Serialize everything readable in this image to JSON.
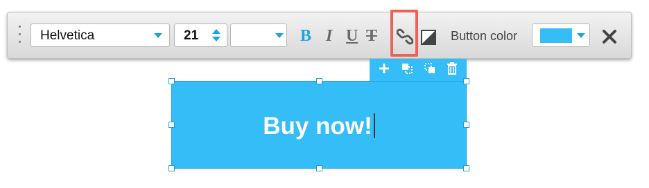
{
  "toolbar": {
    "font_family": "Helvetica",
    "font_size": "21",
    "style_value": "",
    "bold_label": "B",
    "italic_label": "I",
    "underline_label": "U",
    "strike_label": "T",
    "color_label": "Button color",
    "color_value": "#35bdf7"
  },
  "button_element": {
    "text": "Buy now!"
  },
  "colors": {
    "accent": "#1da1e6",
    "button_fill": "#35bdf7",
    "highlight": "#f06055"
  }
}
